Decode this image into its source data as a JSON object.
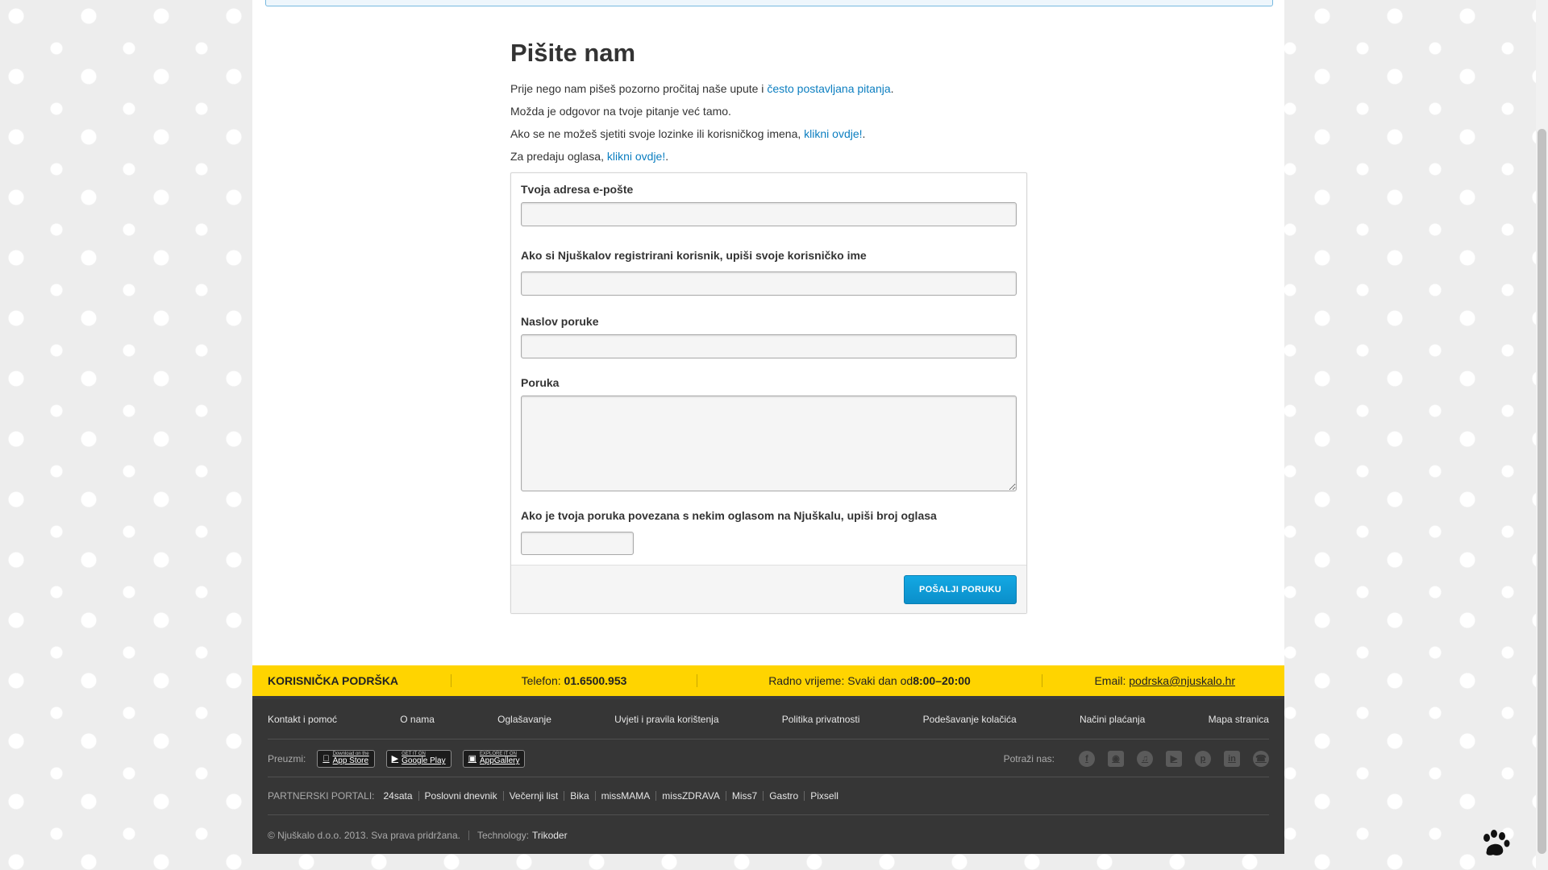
{
  "page": {
    "title": "Pišite nam"
  },
  "info": {
    "line1_prefix": "Prije nego nam pišeš pozorno pročitaj naše upute i ",
    "line1_link": "često postavljana pitanja",
    "line1_suffix": ".",
    "line2": "Možda je odgovor na tvoje pitanje već tamo.",
    "line3_prefix": "Ako se ne možeš sjetiti svoje lozinke ili korisničkog imena, ",
    "line3_link": "klikni ovdje!",
    "line3_suffix": ".",
    "line4_prefix": "Za predaju oglasa, ",
    "line4_link": "klikni ovdje!",
    "line4_suffix": "."
  },
  "form": {
    "email_label": "Tvoja adresa e-pošte",
    "email_value": "",
    "username_label": "Ako si Njuškalov registrirani korisnik, upiši svoje korisničko ime",
    "username_value": "",
    "subject_label": "Naslov poruke",
    "subject_value": "",
    "message_label": "Poruka",
    "message_value": "",
    "ad_number_label": "Ako je tvoja poruka povezana s nekim oglasom na Njuškalu, upiši broj oglasa",
    "ad_number_value": "",
    "submit_label": "POŠALJI PORUKU"
  },
  "support": {
    "title": "KORISNIČKA PODRŠKA",
    "phone_label": "Telefon: ",
    "phone_value": "01.6500.953",
    "hours_label": "Radno vrijeme: Svaki dan od ",
    "hours_value": "8:00–20:00",
    "email_label": "Email: ",
    "email_value": "podrska@njuskalo.hr"
  },
  "footer": {
    "links": [
      "Kontakt i pomoć",
      "O nama",
      "Oglašavanje",
      "Uvjeti i pravila korištenja",
      "Politika privatnosti",
      "Podešavanje kolačića",
      "Načini plaćanja",
      "Mapa stranica"
    ],
    "download_label": "Preuzmi:",
    "stores": [
      {
        "small": "Download on the",
        "big": "App Store",
        "icon": "apple-icon"
      },
      {
        "small": "GET IT ON",
        "big": "Google Play",
        "icon": "google-play-icon"
      },
      {
        "small": "EXPLORE IT ON",
        "big": "AppGallery",
        "icon": "appgallery-icon"
      }
    ],
    "social_label": "Potraži nas:",
    "social_icons": [
      "facebook-icon",
      "instagram-icon",
      "tiktok-icon",
      "youtube-icon",
      "pinterest-icon",
      "linkedin-icon",
      "viber-icon"
    ],
    "partners_label": "PARTNERSKI PORTALI:",
    "partners": [
      "24sata",
      "Poslovni dnevnik",
      "Večernji list",
      "Bika",
      "missMAMA",
      "missZDRAVA",
      "Miss7",
      "Gastro",
      "Pixsell"
    ],
    "copyright": "© Njuškalo d.o.o. 2013. Sva prava pridržana.",
    "technology_label": "Technology:",
    "technology_value": "Trikoder"
  },
  "colors": {
    "accent_blue": "#0b7ec0",
    "support_yellow": "#ffd400",
    "footer_dark": "#363636"
  }
}
